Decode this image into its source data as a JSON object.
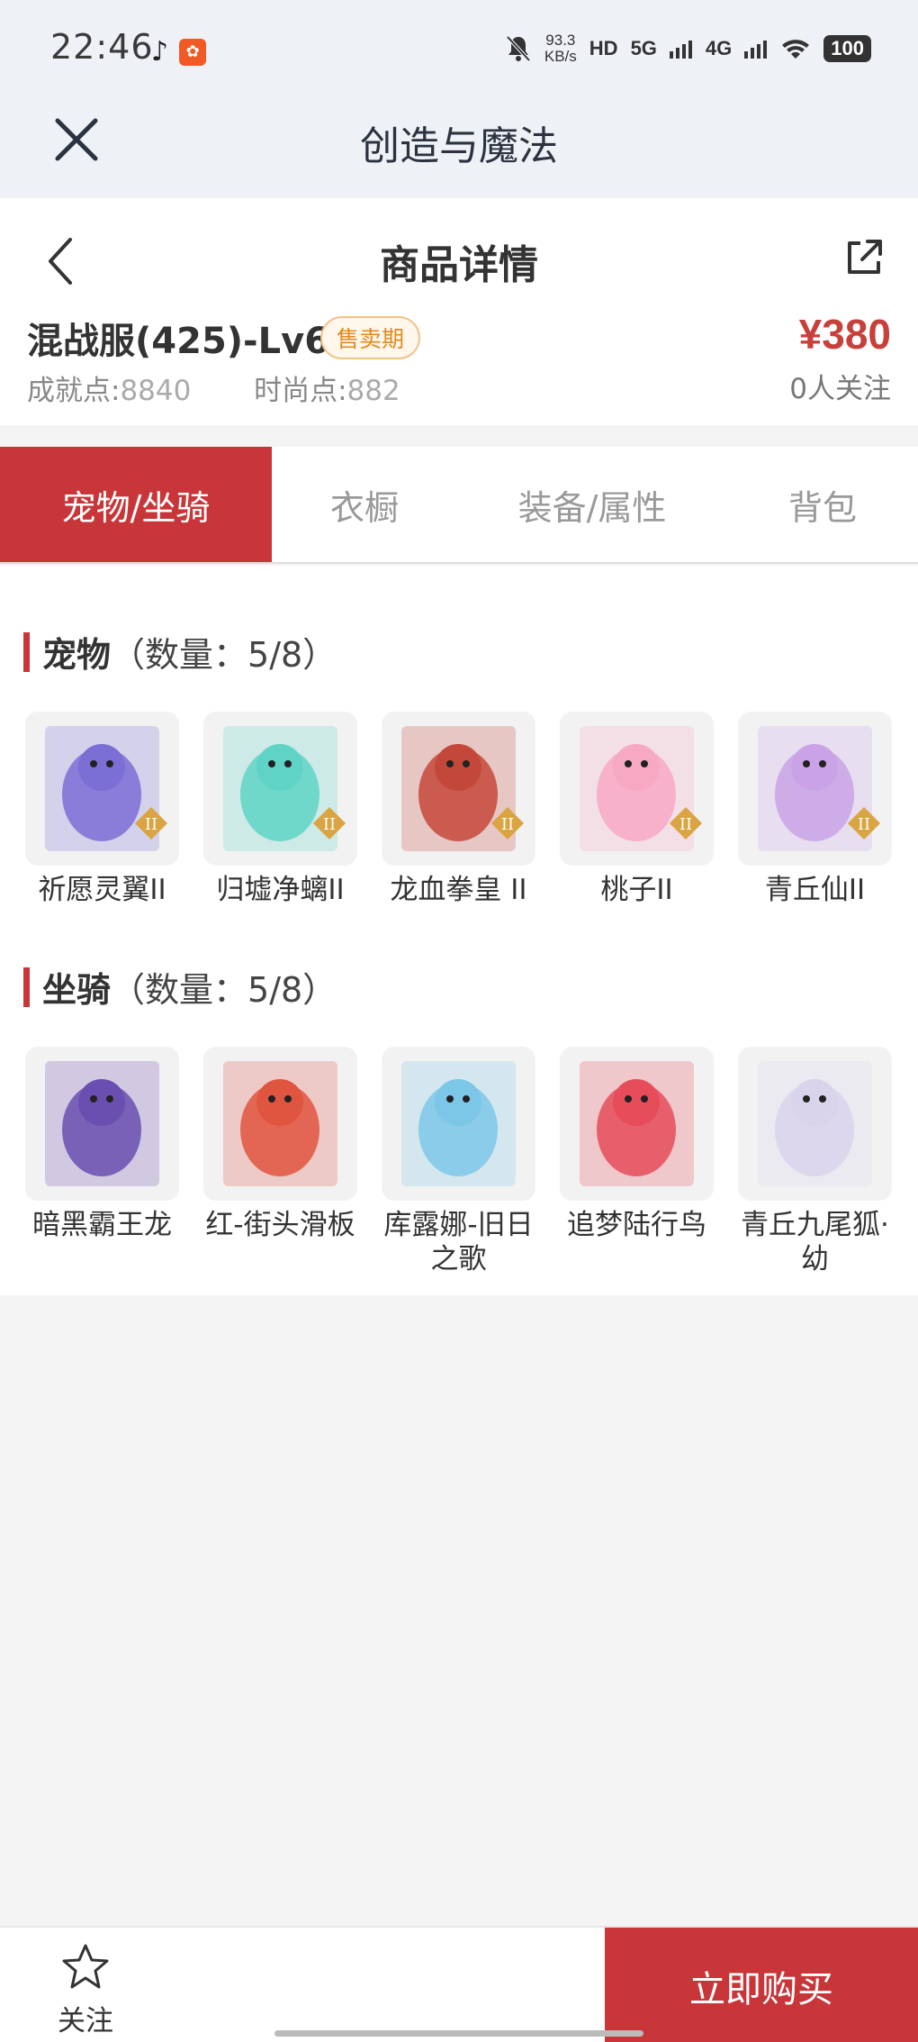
{
  "status_bar": {
    "time": "22:46",
    "net_speed": "93.3",
    "net_unit": "KB/s",
    "hd": "HD",
    "signal1": "5G",
    "signal2": "4G",
    "battery": "100"
  },
  "app_bar": {
    "title": "创造与魔法"
  },
  "header": {
    "title": "商品详情",
    "goods_name": "混战服(425)-Lv69",
    "badge": "售卖期",
    "price": "¥380",
    "achievement_label": "成就点:",
    "achievement_value": "8840",
    "fashion_label": "时尚点:",
    "fashion_value": "882",
    "followers": "0人关注"
  },
  "tabs": [
    {
      "label": "宠物/坐骑",
      "active": true
    },
    {
      "label": "衣橱",
      "active": false
    },
    {
      "label": "装备/属性",
      "active": false
    },
    {
      "label": "背包",
      "active": false
    }
  ],
  "pets": {
    "title": "宠物",
    "count": "（数量：5/8）",
    "items": [
      {
        "name": "祈愿灵翼II",
        "color": "#7b6fd6"
      },
      {
        "name": "归墟净螭II",
        "color": "#5fd3c6"
      },
      {
        "name": "龙血拳皇 II",
        "color": "#c4483a"
      },
      {
        "name": "桃子II",
        "color": "#f7a9c4"
      },
      {
        "name": "青丘仙II",
        "color": "#c9a3e6"
      }
    ]
  },
  "mounts": {
    "title": "坐骑",
    "count": "（数量：5/8）",
    "items": [
      {
        "name": "暗黑霸王龙",
        "color": "#6a4fb0"
      },
      {
        "name": "红-街头滑板",
        "color": "#e0553f"
      },
      {
        "name": "库露娜-旧日之歌",
        "color": "#7cc7e8"
      },
      {
        "name": "追梦陆行鸟",
        "color": "#e64c5a"
      },
      {
        "name": "青丘九尾狐·幼",
        "color": "#d9d4ec"
      }
    ]
  },
  "bottom": {
    "follow_label": "关注",
    "buy_label": "立即购买"
  },
  "colors": {
    "accent": "#c8363a",
    "badge": "#e08a1e"
  }
}
